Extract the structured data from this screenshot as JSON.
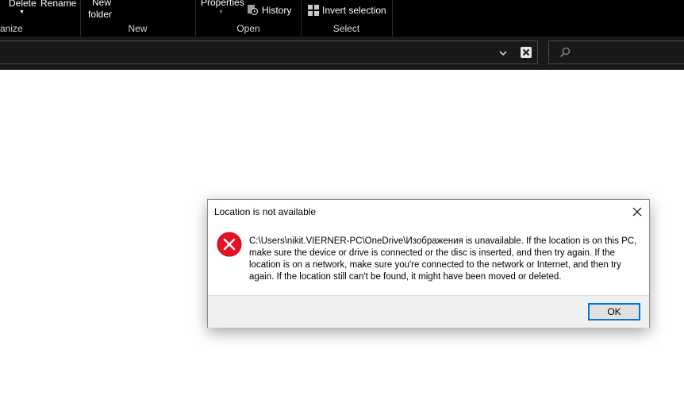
{
  "ribbon": {
    "organize": {
      "delete_label": "Delete",
      "rename_label": "Rename",
      "group_label": "anize"
    },
    "new": {
      "new_folder_line1": "New",
      "new_folder_line2": "folder",
      "group_label": "New"
    },
    "open": {
      "properties_label": "Properties",
      "history_label": "History",
      "group_label": "Open"
    },
    "select": {
      "invert_label": "Invert selection",
      "group_label": "Select"
    }
  },
  "address_bar": {
    "path": "",
    "search_placeholder": ""
  },
  "dialog": {
    "title": "Location is not available",
    "message": "C:\\Users\\nikit.VIERNER-PC\\OneDrive\\Изображения is unavailable. If the location is on this PC, make sure the device or drive is connected or the disc is inserted, and then try again. If the location is on a network, make sure you're connected to the network or Internet, and then try again. If the location still can't be found, it might have been moved or deleted.",
    "ok_label": "OK",
    "error_color": "#e81123",
    "accent_color": "#0078d7"
  }
}
